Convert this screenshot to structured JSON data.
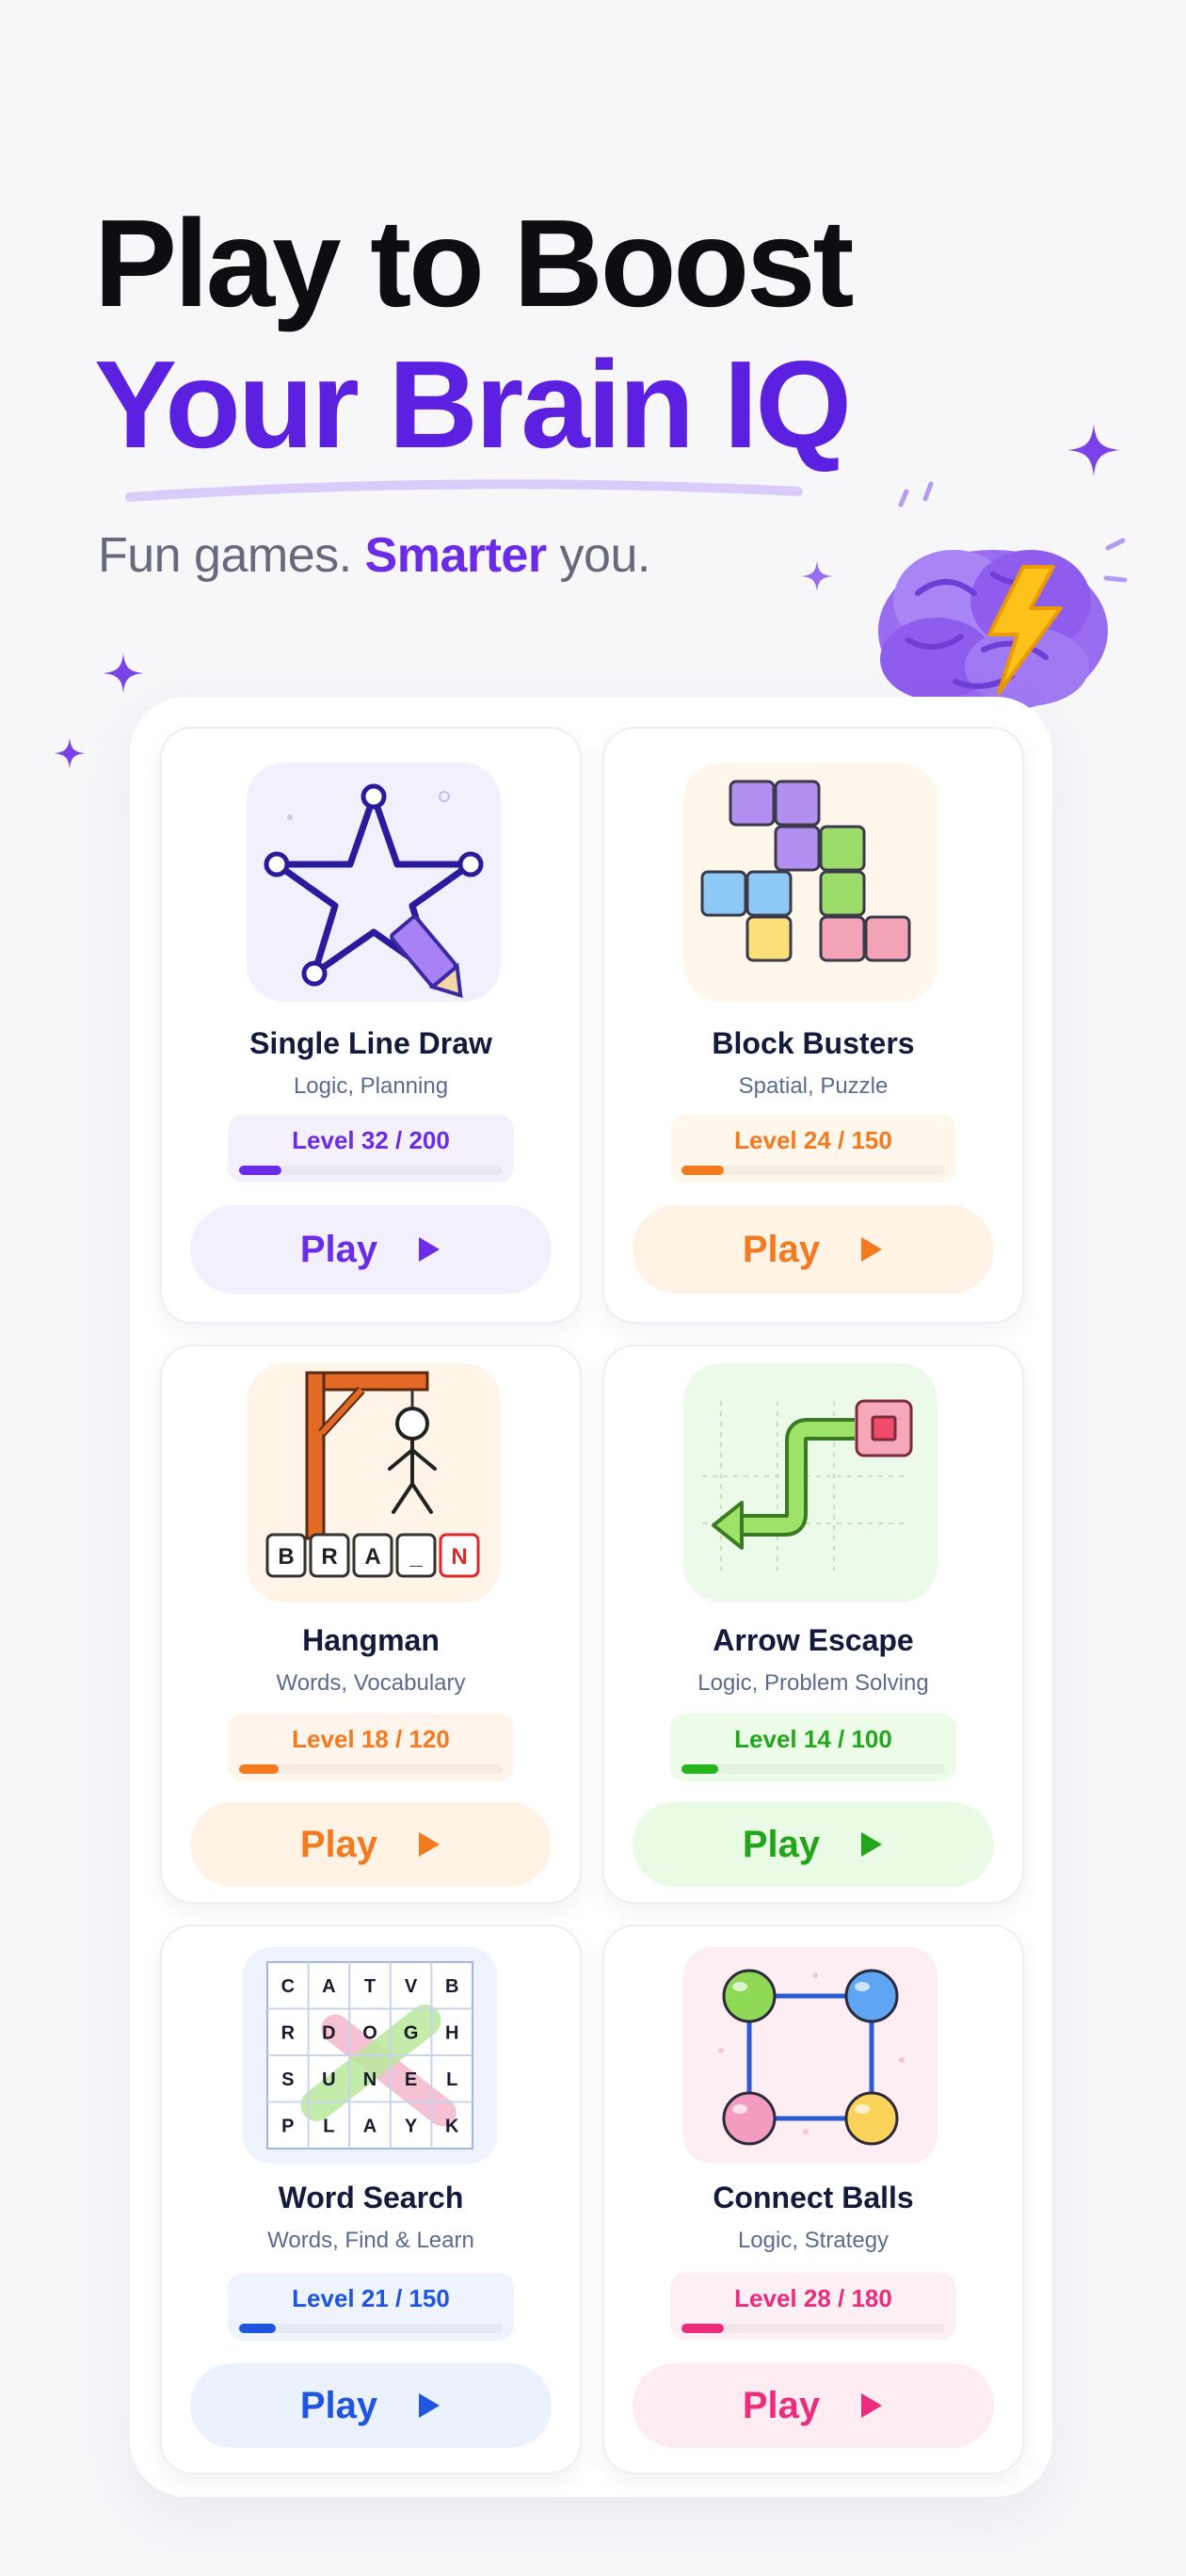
{
  "hero": {
    "title_line1": "Play to Boost",
    "title_line2": "Your Brain IQ",
    "subtitle_pre": "Fun games. ",
    "subtitle_highlight": "Smarter",
    "subtitle_post": " you."
  },
  "games": [
    {
      "title": "Single Line Draw",
      "tags": "Logic, Planning",
      "level": "Level 32 / 200",
      "progress": 0.16,
      "play_label": "Play",
      "color": "#6a2ce6",
      "bg": "#f3f0fd",
      "icon": "star-pencil-icon"
    },
    {
      "title": "Block Busters",
      "tags": "Spatial, Puzzle",
      "level": "Level 24 / 150",
      "progress": 0.16,
      "play_label": "Play",
      "color": "#f47a1f",
      "bg": "#fff4e8",
      "icon": "blocks-icon"
    },
    {
      "title": "Hangman",
      "tags": "Words, Vocabulary",
      "level": "Level 18 / 120",
      "progress": 0.15,
      "play_label": "Play",
      "color": "#f47a1f",
      "bg": "#fff4e8",
      "icon": "hangman-icon"
    },
    {
      "title": "Arrow Escape",
      "tags": "Logic, Problem Solving",
      "level": "Level 14 / 100",
      "progress": 0.14,
      "play_label": "Play",
      "color": "#26b51f",
      "bg": "#eafbe8",
      "icon": "arrow-path-icon"
    },
    {
      "title": "Word Search",
      "tags": "Words, Find & Learn",
      "level": "Level 21 / 150",
      "progress": 0.14,
      "play_label": "Play",
      "color": "#1f55e0",
      "bg": "#edf3fe",
      "icon": "word-grid-icon"
    },
    {
      "title": "Connect Balls",
      "tags": "Logic, Strategy",
      "level": "Level 28 / 180",
      "progress": 0.16,
      "play_label": "Play",
      "color": "#ec2d7d",
      "bg": "#fdeef4",
      "icon": "connect-balls-icon"
    }
  ],
  "thumb_text": {
    "hangman_letters": [
      "B",
      "R",
      "A",
      "_",
      "N"
    ],
    "word_grid": [
      [
        "C",
        "A",
        "T",
        "V",
        "B"
      ],
      [
        "R",
        "D",
        "O",
        "G",
        "H"
      ],
      [
        "S",
        "U",
        "N",
        "E",
        "L"
      ],
      [
        "P",
        "L",
        "A",
        "Y",
        "K"
      ]
    ]
  }
}
